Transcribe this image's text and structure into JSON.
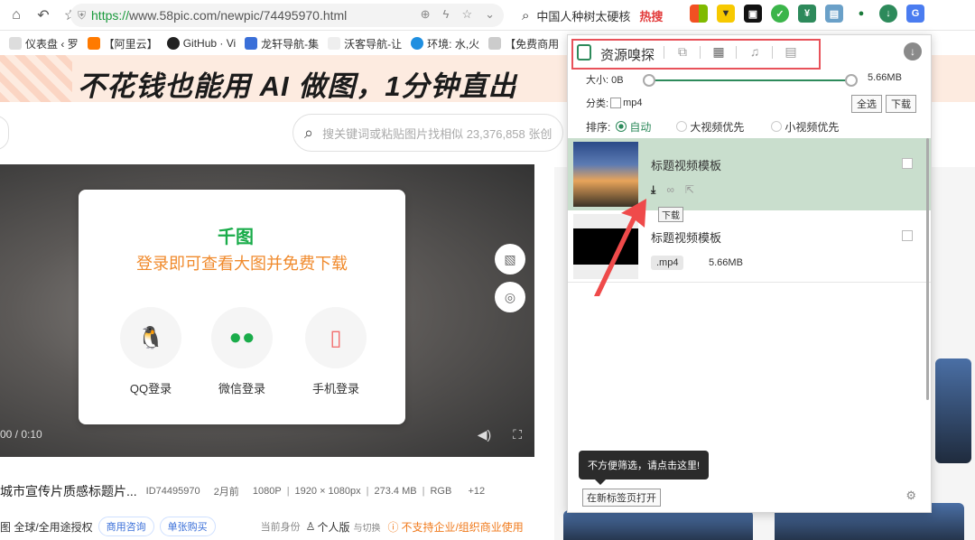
{
  "browser": {
    "url_https": "https://",
    "url_rest": "www.58pic.com/newpic/74495970.html",
    "search_text": "中国人种树太硬核",
    "hot_label": "热搜"
  },
  "bookmarks": [
    "仪表盘 ‹ 罗",
    "【阿里云】",
    "GitHub · Vi",
    "龙轩导航-集",
    "沃客导航-让",
    "环境: 水,火",
    "【免费商用"
  ],
  "banner": {
    "text": "不花钱也能用 AI 做图，1分钟直出"
  },
  "site": {
    "search_placeholder": "搜关键词或粘贴图片找相似 23,376,858 张创",
    "video_time": "00 / 0:10",
    "login": {
      "logo": "千图",
      "title": "登录即可查看大图并免费下载",
      "options": [
        "QQ登录",
        "微信登录",
        "手机登录"
      ]
    },
    "info": {
      "title": "城市宣传片质感标题片...",
      "id": "ID74495970",
      "date": "2月前",
      "res": "1080P",
      "dim": "1920 × 1080px",
      "size": "273.4 MB",
      "mode": "RGB",
      "extra": "+12"
    },
    "license": {
      "text": "图 全球/全用途授权",
      "btn1": "商用咨询",
      "btn2": "单张购买",
      "identity": "当前身份",
      "person": "个人版",
      "switch": "与切换",
      "warn": "不支持企业/组织商业使用"
    }
  },
  "popup": {
    "title": "资源嗅探",
    "size_label": "大小: 0B",
    "size_max": "5.66MB",
    "size_min_fraction": 0.0,
    "size_max_fraction": 1.0,
    "category_label": "分类:",
    "category_mp4": "mp4",
    "select_all": "全选",
    "download": "下载",
    "sort_label": "排序:",
    "sort_options": [
      "自动",
      "大视频优先",
      "小视频优先"
    ],
    "items": [
      {
        "name": "标题视频模板",
        "tooltip": "下载"
      },
      {
        "name": "标题视频模板",
        "format": ".mp4",
        "size": "5.66MB"
      }
    ],
    "filter_tip": "不方便筛选，请点击这里!",
    "open_newtab": "在新标签页打开"
  },
  "colors": {
    "accent": "#2d8a5b",
    "highlight": "#e8525a",
    "active_row": "#c9decd"
  }
}
